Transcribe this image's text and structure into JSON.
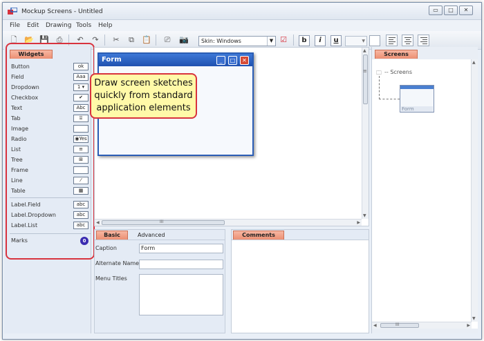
{
  "window": {
    "title": "Mockup Screens - Untitled",
    "controls": [
      "▭",
      "□",
      "✕"
    ]
  },
  "menu": [
    "File",
    "Edit",
    "Drawing",
    "Tools",
    "Help"
  ],
  "toolbar": {
    "skin_label": "Skin: Windows",
    "bold": "b",
    "italic": "i",
    "underline": "u"
  },
  "widgets_panel": {
    "tab": "Widgets",
    "items": [
      {
        "label": "Button",
        "icon": "ok"
      },
      {
        "label": "Field",
        "icon": "Aaa"
      },
      {
        "label": "Dropdown",
        "icon": "1 ▾"
      },
      {
        "label": "Checkbox",
        "icon": "✔"
      },
      {
        "label": "Text",
        "icon": "Abc"
      },
      {
        "label": "Tab",
        "icon": "⌸"
      },
      {
        "label": "Image",
        "icon": ""
      },
      {
        "label": "Radio",
        "icon": "◉Yes"
      },
      {
        "label": "List",
        "icon": "≡"
      },
      {
        "label": "Tree",
        "icon": "⊞"
      },
      {
        "label": "Frame",
        "icon": ""
      },
      {
        "label": "Line",
        "icon": "⁄"
      },
      {
        "label": "Table",
        "icon": "▦"
      }
    ],
    "label_items": [
      {
        "label": "Label.Field",
        "icon": "abc"
      },
      {
        "label": "Label.Dropdown",
        "icon": "abc"
      },
      {
        "label": "Label.List",
        "icon": "abc"
      }
    ],
    "marks": {
      "label": "Marks",
      "badge": "0"
    }
  },
  "canvas": {
    "form": {
      "title": "Form",
      "buttons": [
        "_",
        "□",
        "✕"
      ]
    },
    "callout": [
      "Draw screen sketches",
      "quickly from standard",
      "application elements"
    ]
  },
  "properties": {
    "tabs": [
      "Basic",
      "Advanced"
    ],
    "fields": [
      {
        "label": "Caption",
        "value": "Form"
      },
      {
        "label": "Alternate Name",
        "value": ""
      },
      {
        "label": "Menu Titles",
        "value": ""
      }
    ]
  },
  "comments": {
    "tab": "Comments"
  },
  "screens": {
    "tab": "Screens",
    "tree_root": "-- Screens",
    "thumbnail_label": "Form"
  },
  "scroll": {
    "grip": "III",
    "vgrip": "≡"
  },
  "colors": {
    "accent_tab": "#ec8f73",
    "highlight": "#d8323d",
    "callout": "#fff9a8",
    "form_title": "#1f51b0"
  }
}
